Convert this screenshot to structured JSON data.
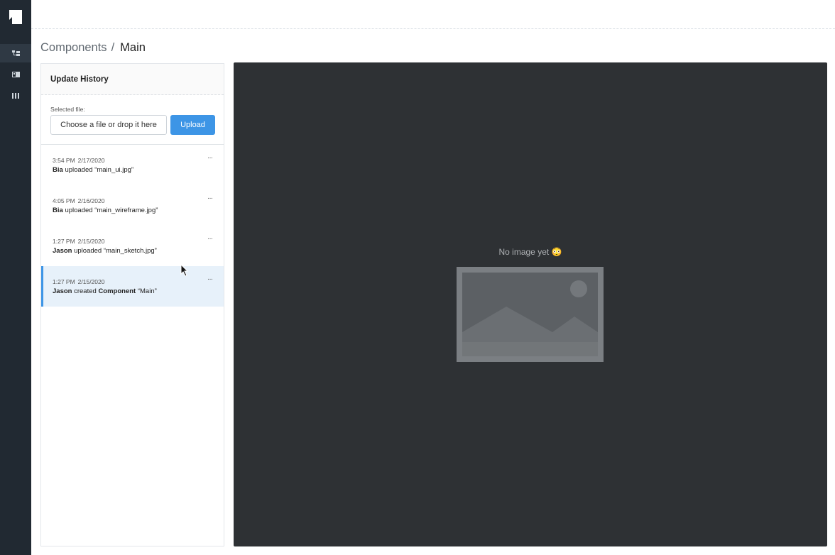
{
  "breadcrumb": {
    "parent": "Components",
    "separator": "/",
    "current": "Main"
  },
  "panel": {
    "title": "Update History",
    "upload": {
      "label": "Selected file:",
      "input_text": "Choose a file or drop it here",
      "button": "Upload"
    },
    "history": [
      {
        "time": "3:54 PM",
        "date": "2/17/2020",
        "user": "Bia",
        "action": "uploaded",
        "object": "",
        "target": "“main_ui.jpg”",
        "more": "···"
      },
      {
        "time": "4:05 PM",
        "date": "2/16/2020",
        "user": "Bia",
        "action": "uploaded",
        "object": "",
        "target": "“main_wireframe.jpg”",
        "more": "···"
      },
      {
        "time": "1:27 PM",
        "date": "2/15/2020",
        "user": "Jason",
        "action": "uploaded",
        "object": "",
        "target": "“main_sketch.jpg”",
        "more": "···"
      },
      {
        "time": "1:27 PM",
        "date": "2/15/2020",
        "user": "Jason",
        "action": "created",
        "object": "Component",
        "target": "“Main”",
        "more": "···"
      }
    ],
    "selected_index": 3
  },
  "viewer": {
    "empty_text": "No image yet 😳"
  },
  "icons": {
    "rail": [
      "app-logo-icon",
      "component-tree-icon",
      "image-icon",
      "columns-icon"
    ]
  },
  "colors": {
    "rail_bg": "#212932",
    "accent": "#3d95e6",
    "viewer_bg": "#2e3134",
    "selected_bg": "#e7f1fa"
  }
}
